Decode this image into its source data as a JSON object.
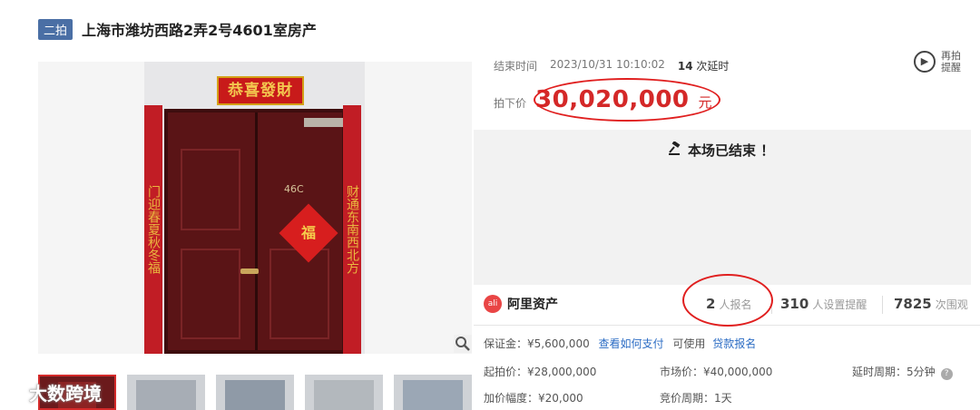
{
  "header": {
    "badge": "二拍",
    "title": "上海市潍坊西路2弄2号4601室房产"
  },
  "photo": {
    "banner_text": "恭喜發財",
    "couplet_left": "门迎春夏秋冬福",
    "couplet_right": "财通东南西北方",
    "door_number": "46C",
    "fu_char": "福",
    "zoom_icon": "magnifier-icon"
  },
  "thumbnails": [
    {
      "name": "thumb-1",
      "active": true
    },
    {
      "name": "thumb-2",
      "active": false
    },
    {
      "name": "thumb-3",
      "active": false
    },
    {
      "name": "thumb-4",
      "active": false
    },
    {
      "name": "thumb-5",
      "active": false
    }
  ],
  "watermark": {
    "text": "大数跨境",
    "icon": "brand-logo-icon"
  },
  "auction": {
    "end_label": "结束时间",
    "end_time": "2023/10/31 10:10:02",
    "delay_count": "14",
    "delay_label": "次延时",
    "remind_label": "再拍提醒",
    "price_label": "拍下价",
    "price": "30,020,000",
    "price_unit": "元",
    "status": "本场已结束 ！"
  },
  "stats": {
    "platform": "阿里资产",
    "signups_num": "2",
    "signups_label": "人报名",
    "reminders_num": "310",
    "reminders_label": "人设置提醒",
    "views_num": "7825",
    "views_label": "次围观"
  },
  "details": {
    "deposit": "保证金：¥5,600,000",
    "deposit_link1": "查看如何支付",
    "deposit_mid": "可使用",
    "deposit_link2": "贷款报名",
    "start_price": "起拍价：¥28,000,000",
    "market_price": "市场价：¥40,000,000",
    "delay_period": "延时周期：5分钟",
    "increment": "加价幅度：¥20,000",
    "bid_period": "竞价周期：1天"
  },
  "colors": {
    "accent_red": "#d42828",
    "badge_blue": "#4a6fa5",
    "link_blue": "#2b6cc4"
  }
}
